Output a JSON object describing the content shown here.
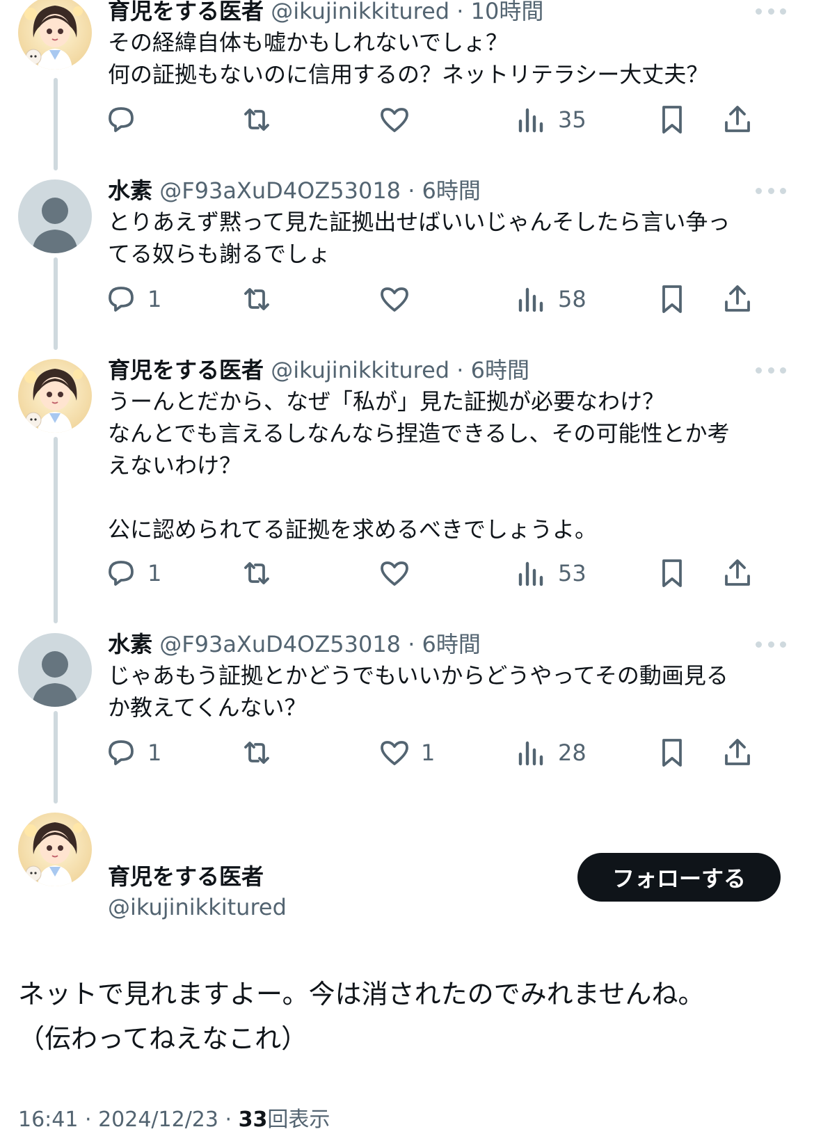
{
  "thread": [
    {
      "author": "育児をする医者",
      "handle": "@ikujinikkitured",
      "time": "10時間",
      "meta": "@ikujinikkitured · 10時間",
      "lines": [
        "その経緯自体も嘘かもしれないでしょ？",
        "何の証拠もないのに信用するの？ネットリテラシー大丈夫？"
      ],
      "replies": "",
      "reposts": "",
      "likes": "",
      "views": "35"
    },
    {
      "author": "水素",
      "handle": "@F93aXuD4OZ53018",
      "time": "6時間",
      "meta": "@F93aXuD4OZ53018 · 6時間",
      "lines": [
        "とりあえず黙って見た証拠出せばいいじゃんそしたら言い争っ",
        "てる奴らも謝るでしょ"
      ],
      "replies": "1",
      "reposts": "",
      "likes": "",
      "views": "58"
    },
    {
      "author": "育児をする医者",
      "handle": "@ikujinikkitured",
      "time": "6時間",
      "meta": "@ikujinikkitured · 6時間",
      "lines": [
        "うーんとだから、なぜ「私が」見た証拠が必要なわけ？",
        "なんとでも言えるしなんなら捏造できるし、その可能性とか考",
        "えないわけ？",
        "",
        "公に認められてる証拠を求めるべきでしょうよ。"
      ],
      "replies": "1",
      "reposts": "",
      "likes": "",
      "views": "53"
    },
    {
      "author": "水素",
      "handle": "@F93aXuD4OZ53018",
      "time": "6時間",
      "meta": "@F93aXuD4OZ53018 · 6時間",
      "lines": [
        "じゃあもう証拠とかどうでもいいからどうやってその動画見る",
        "か教えてくんない？"
      ],
      "replies": "1",
      "reposts": "",
      "likes": "1",
      "views": "28"
    }
  ],
  "main_post": {
    "author": "育児をする医者",
    "handle": "@ikujinikkitured",
    "follow_label": "フォローする",
    "text_lines": [
      "ネットで見れますよー。今は消されたのでみれませんね。",
      "（伝わってねえなこれ）"
    ],
    "timestamp": "16:41 · 2024/12/23 · ",
    "view_count": "33",
    "view_label": "回表示"
  },
  "colors": {
    "text": "#0f1419",
    "secondary": "#536471",
    "thread_line": "#cfd9de",
    "follow_bg": "#0f1419",
    "default_avatar_bg": "#cfd9de",
    "default_avatar_fg": "#66757f"
  },
  "icons": [
    "reply-icon",
    "repost-icon",
    "like-icon",
    "views-icon",
    "bookmark-icon",
    "share-icon",
    "more-icon",
    "anime-doctor-avatar",
    "default-avatar"
  ]
}
